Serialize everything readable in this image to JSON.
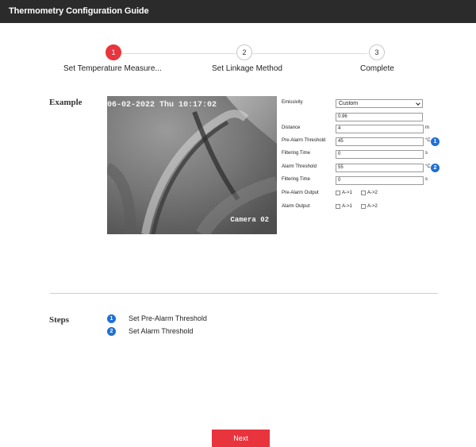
{
  "window": {
    "title": "Thermometry Configuration Guide"
  },
  "stepper": {
    "steps": [
      {
        "number": "1",
        "label": "Set Temperature Measure..."
      },
      {
        "number": "2",
        "label": "Set Linkage Method"
      },
      {
        "number": "3",
        "label": "Complete"
      }
    ]
  },
  "example": {
    "label": "Example",
    "camera": {
      "datetime": "06-02-2022 Thu 10:17:02",
      "name": "Camera 02"
    },
    "form": {
      "emissivity": {
        "label": "Emissivity",
        "selected": "Custom",
        "value": "0.96"
      },
      "distance": {
        "label": "Distance",
        "value": "4",
        "unit": "m"
      },
      "pre_alarm_threshold": {
        "label": "Pre-Alarm Threshold",
        "value": "45",
        "unit": "°C",
        "badge": "1"
      },
      "filtering_time_1": {
        "label": "Filtering Time",
        "value": "0",
        "unit": "s"
      },
      "alarm_threshold": {
        "label": "Alarm Threshold",
        "value": "55",
        "unit": "°C",
        "badge": "2"
      },
      "filtering_time_2": {
        "label": "Filtering Time",
        "value": "0",
        "unit": "s"
      },
      "pre_alarm_output": {
        "label": "Pre-Alarm Output",
        "options": [
          "A->1",
          "A->2"
        ]
      },
      "alarm_output": {
        "label": "Alarm Output",
        "options": [
          "A->1",
          "A->2"
        ]
      }
    }
  },
  "steps": {
    "label": "Steps",
    "items": [
      {
        "badge": "1",
        "text": "Set Pre-Alarm Threshold"
      },
      {
        "badge": "2",
        "text": "Set Alarm Threshold"
      }
    ]
  },
  "footer": {
    "next_label": "Next"
  },
  "colors": {
    "accent_red": "#e8343d",
    "badge_blue": "#1f6fd6",
    "titlebar": "#2b2b2b"
  }
}
